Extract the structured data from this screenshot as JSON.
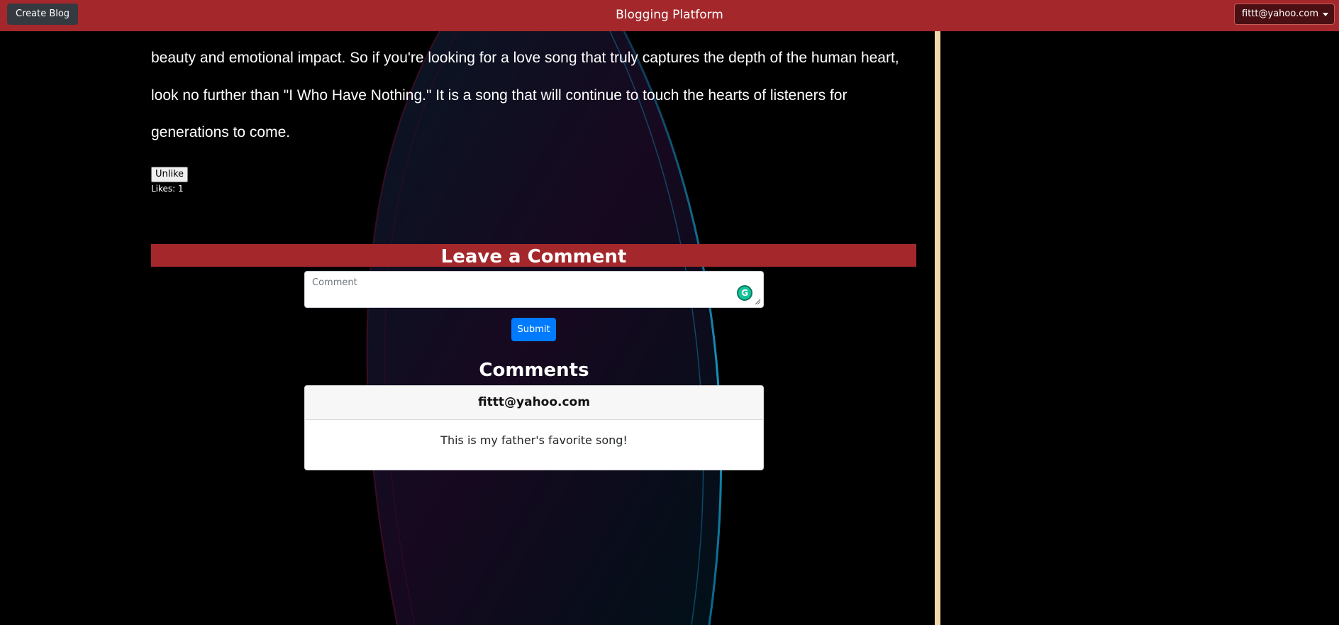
{
  "navbar": {
    "create_label": "Create Blog",
    "brand": "Blogging Platform",
    "user_email": "fittt@yahoo.com"
  },
  "article": {
    "lines": [
      "beauty and emotional impact. So if you're looking for a love song that truly captures the depth of the human heart,",
      "look no further than \"I Who Have Nothing.\" It is a song that will continue to touch the hearts of listeners for",
      "generations to come."
    ],
    "unlike_label": "Unlike",
    "likes_text": "Likes: 1"
  },
  "comment_form": {
    "heading": "Leave a Comment",
    "placeholder": "Comment",
    "submit_label": "Submit",
    "grammarly_glyph": "G"
  },
  "comments": {
    "heading": "Comments",
    "items": [
      {
        "author": "fittt@yahoo.com",
        "text": "This is my father's favorite song!"
      }
    ]
  },
  "colors": {
    "navbar": "#a4282b",
    "accent_button": "#007bff",
    "divider": "#f4d7a8"
  }
}
